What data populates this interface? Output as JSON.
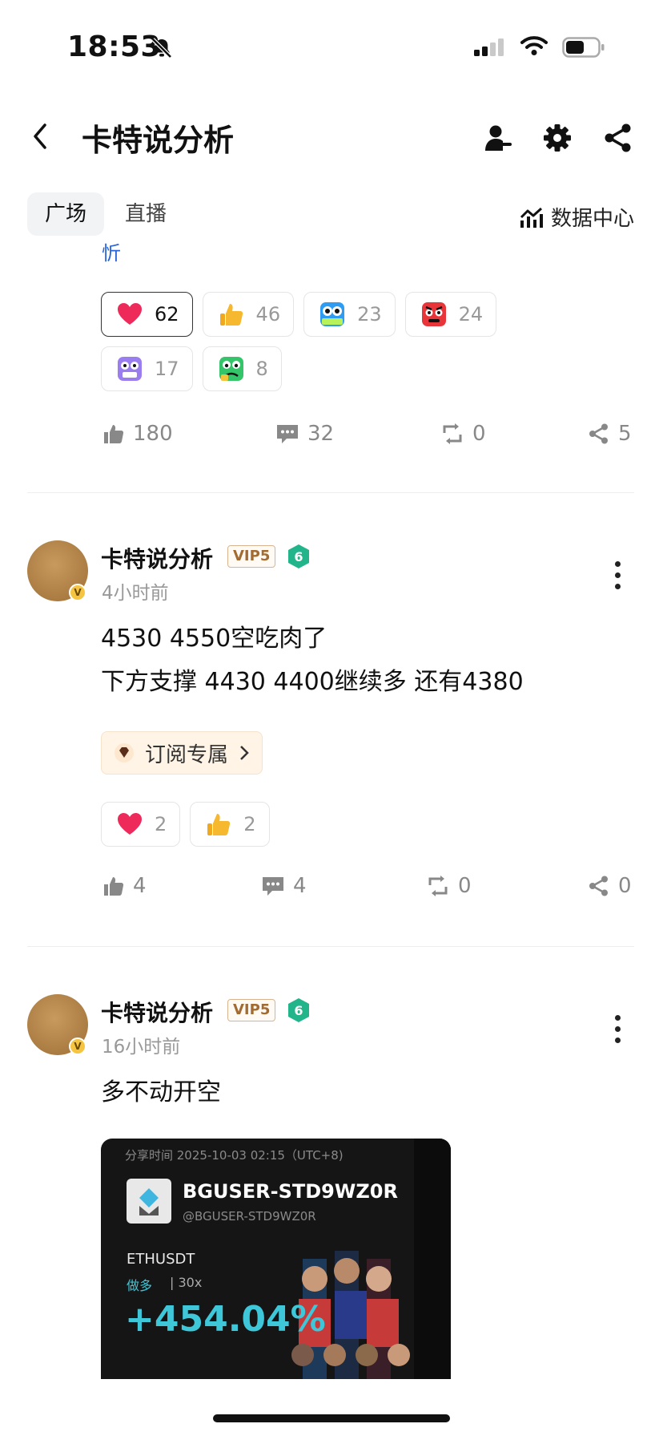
{
  "status": {
    "time": "18:53"
  },
  "header": {
    "title": "卡特说分析"
  },
  "tabs": {
    "square": "广场",
    "live": "直播",
    "data_center": "数据中心"
  },
  "cut_text": "忻",
  "post0": {
    "reactions": [
      {
        "emoji": "heart-icon",
        "count": "62",
        "selected": true
      },
      {
        "emoji": "thumbs-up-icon",
        "count": "46"
      },
      {
        "emoji": "hodl-owl-icon",
        "count": "23"
      },
      {
        "emoji": "angry-face-icon",
        "count": "24"
      },
      {
        "emoji": "scared-face-icon",
        "count": "17"
      },
      {
        "emoji": "sad-frog-icon",
        "count": "8"
      }
    ],
    "likes": "180",
    "comments": "32",
    "reposts": "0",
    "shares": "5"
  },
  "post1": {
    "author": "卡特说分析",
    "vip": "VIP5",
    "level": "6",
    "time": "4小时前",
    "line1": "4530 4550空吃肉了",
    "line2": "下方支撑 4430 4400继续多 还有4380",
    "subscribe": "订阅专属",
    "reactions": [
      {
        "emoji": "heart-icon",
        "count": "2"
      },
      {
        "emoji": "thumbs-up-icon",
        "count": "2"
      }
    ],
    "likes": "4",
    "comments": "4",
    "reposts": "0",
    "shares": "0"
  },
  "post2": {
    "author": "卡特说分析",
    "vip": "VIP5",
    "level": "6",
    "time": "16小时前",
    "line1": "多不动开空",
    "card": {
      "share_time": "分享时间 2025-10-03 02:15（UTC+8)",
      "username": "BGUSER-STD9WZ0R",
      "handle": "@BGUSER-STD9WZ0R",
      "pair": "ETHUSDT",
      "side": "做多",
      "leverage": "30x",
      "pnl": "+454.04%"
    }
  },
  "avatar_badge": "V"
}
